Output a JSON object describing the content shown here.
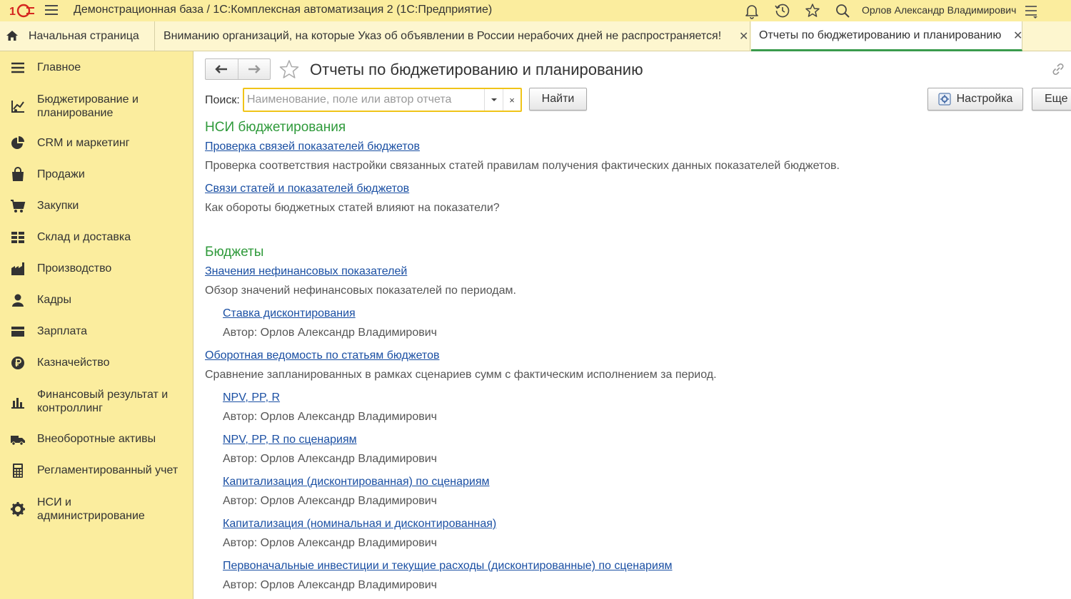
{
  "titlebar": {
    "title": "Демонстрационная база / 1С:Комплексная автоматизация 2  (1С:Предприятие)",
    "user": "Орлов Александр Владимирович",
    "icons": [
      "bell-icon",
      "history-icon",
      "star-icon",
      "search-icon",
      "menu-icon"
    ]
  },
  "tabs": {
    "home": "Начальная страница",
    "notice": "Вниманию организаций, на которые Указ об объявлении в России нерабочих дней не распространяется!",
    "reports": "Отчеты по бюджетированию и планированию",
    "close_glyph": "✕"
  },
  "sidebar": {
    "items": [
      {
        "label": "Главное",
        "icon": "menu-lines-icon"
      },
      {
        "label": "Бюджетирование и планирование",
        "icon": "budget-chart-icon"
      },
      {
        "label": "CRM и маркетинг",
        "icon": "pie-chart-icon"
      },
      {
        "label": "Продажи",
        "icon": "shopping-bag-icon"
      },
      {
        "label": "Закупки",
        "icon": "cart-icon"
      },
      {
        "label": "Склад и доставка",
        "icon": "warehouse-icon"
      },
      {
        "label": "Производство",
        "icon": "factory-icon"
      },
      {
        "label": "Кадры",
        "icon": "person-icon"
      },
      {
        "label": "Зарплата",
        "icon": "wallet-icon"
      },
      {
        "label": "Казначейство",
        "icon": "ruble-coin-icon"
      },
      {
        "label": "Финансовый результат и контроллинг",
        "icon": "bar-chart-icon"
      },
      {
        "label": "Внеоборотные активы",
        "icon": "truck-icon"
      },
      {
        "label": "Регламентированный учет",
        "icon": "calculator-icon"
      },
      {
        "label": "НСИ и администрирование",
        "icon": "gear-icon"
      }
    ]
  },
  "main": {
    "title": "Отчеты по бюджетированию и планированию",
    "search": {
      "label": "Поиск:",
      "placeholder": "Наименование, поле или автор отчета",
      "value": "",
      "clear_glyph": "×"
    },
    "buttons": {
      "find": "Найти",
      "settings": "Настройка",
      "more": "Еще"
    },
    "sections": [
      {
        "title": "НСИ бюджетирования",
        "reports": [
          {
            "name": "Проверка связей показателей бюджетов",
            "desc": "Проверка соответствия настройки связанных статей правилам получения фактических данных показателей бюджетов."
          },
          {
            "name": "Связи статей и показателей бюджетов",
            "desc": "Как обороты бюджетных статей влияют на показатели?"
          }
        ]
      },
      {
        "title": "Бюджеты",
        "reports": [
          {
            "name": "Значения нефинансовых показателей",
            "desc": "Обзор значений нефинансовых показателей по периодам."
          },
          {
            "name": "Ставка дисконтирования",
            "desc": "Автор: Орлов Александр Владимирович"
          },
          {
            "name": "Оборотная ведомость по статьям бюджетов",
            "desc": "Сравнение запланированных в рамках сценариев сумм с фактическим исполнением за период."
          },
          {
            "name": "NPV, PP, R",
            "desc": "Автор: Орлов Александр Владимирович"
          },
          {
            "name": "NPV, PP, R по сценариям",
            "desc": "Автор: Орлов Александр Владимирович"
          },
          {
            "name": "Капитализация (дисконтированная) по сценариям",
            "desc": "Автор: Орлов Александр Владимирович"
          },
          {
            "name": "Капитализация (номинальная и дисконтированная)",
            "desc": "Автор: Орлов Александр Владимирович"
          },
          {
            "name": "Первоначальные инвестиции и текущие расходы (дисконтированные) по сценариям",
            "desc": "Автор: Орлов Александр Владимирович"
          }
        ]
      }
    ]
  }
}
